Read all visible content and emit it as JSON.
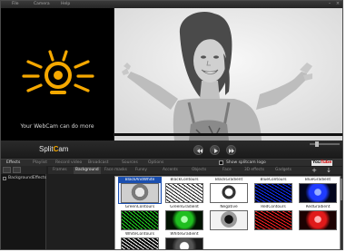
{
  "window": {
    "menu": [
      "File",
      "Camera",
      "Help"
    ],
    "controls": [
      "minimize",
      "close"
    ]
  },
  "brand": {
    "tagline": "Your WebCam can do more",
    "logo_icon": "webcam-icon",
    "accent": "#f5a800"
  },
  "logo": {
    "split": "Split",
    "cam": "C",
    "am": "am"
  },
  "transport": {
    "buttons": [
      "rewind-icon",
      "play-icon",
      "forward-icon"
    ]
  },
  "main_tabs": [
    "Effects",
    "Playlist",
    "Record video",
    "Broadcast",
    "Sources",
    "Options"
  ],
  "main_tabs_active": 0,
  "show_logo_label": "Show splitcam logo",
  "youtube": {
    "you": "You",
    "tube": "Tube"
  },
  "left_list": {
    "toolbar_icons": [
      "folder-icon",
      "layers-icon"
    ],
    "items": [
      "BackgroundEffects"
    ]
  },
  "effect_tabs": [
    "Frames",
    "Background",
    "Face masks",
    "Funny",
    "Accents",
    "Objects",
    "Face",
    "3D effects",
    "Gadgets"
  ],
  "effect_tabs_active": 1,
  "effect_tools": [
    "+",
    "↓"
  ],
  "effects": [
    {
      "name": "BlackAndWhite",
      "style": "bw",
      "selected": true
    },
    {
      "name": "BlackContours",
      "style": "bcontour"
    },
    {
      "name": "BlackGradient",
      "style": "bgrad"
    },
    {
      "name": "BlueContours",
      "style": "bluecontour"
    },
    {
      "name": "BlueGradient",
      "style": "bluegrad"
    },
    {
      "name": "GreenContours",
      "style": "greencontour"
    },
    {
      "name": "GreenGradient",
      "style": "greengrad"
    },
    {
      "name": "Negative",
      "style": "negative"
    },
    {
      "name": "RedContours",
      "style": "redcontour"
    },
    {
      "name": "RedGradient",
      "style": "redgrad"
    },
    {
      "name": "WhiteContours",
      "style": "whitecontour"
    },
    {
      "name": "WhiteGradient",
      "style": "whitegrad"
    }
  ]
}
